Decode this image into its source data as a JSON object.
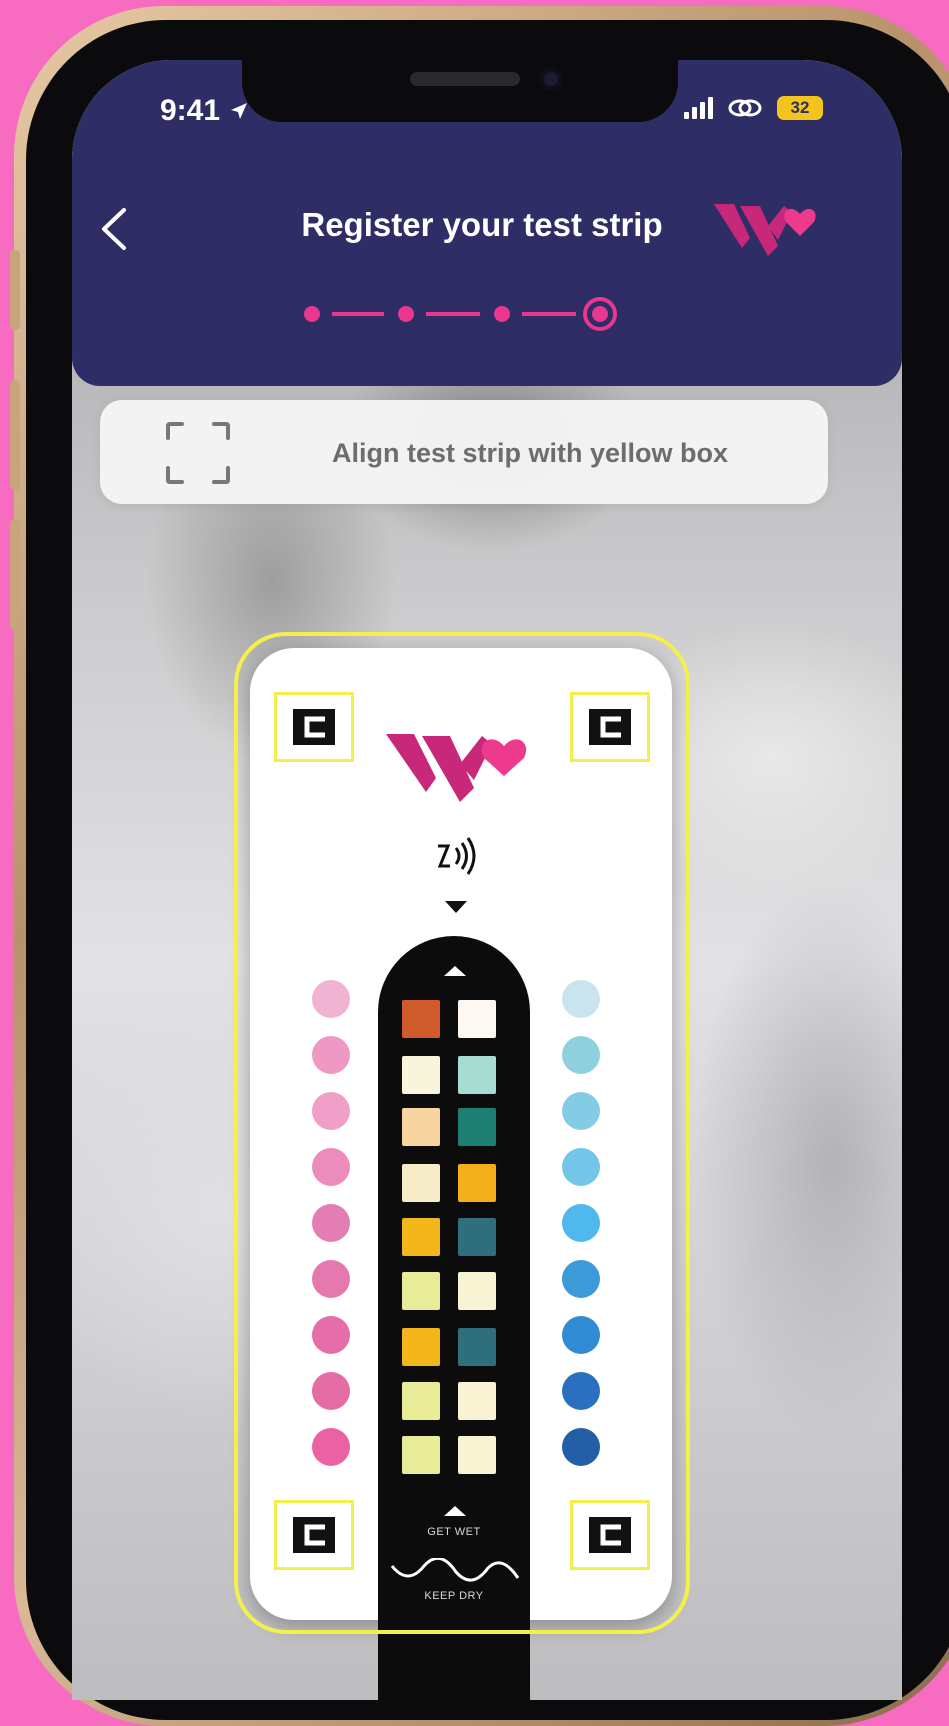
{
  "status_bar": {
    "time": "9:41",
    "battery": "32"
  },
  "header": {
    "title": "Register your test strip",
    "step_current": 4,
    "step_total": 4
  },
  "instruction": {
    "text": "Align test strip with yellow box"
  },
  "strip": {
    "label_get_wet": "GET WET",
    "label_keep_dry": "KEEP DRY",
    "left_dots": [
      "#f0b4d2",
      "#f098c4",
      "#f0a0c8",
      "#ec8cbc",
      "#e47eb2",
      "#e678b0",
      "#e66ea8",
      "#e66ca6",
      "#ea62a2"
    ],
    "right_dots": [
      "#c9e4ec",
      "#8ed0de",
      "#84cce6",
      "#74c6e8",
      "#4fb8ec",
      "#3c9ad8",
      "#308ad4",
      "#2a70be",
      "#245ea6"
    ],
    "pads_left": [
      "#cf5a2a",
      "#f9f5dc",
      "#f7d4a0",
      "#f7ecc8",
      "#f3b71c",
      "#e9ec96",
      "#f3b71c",
      "#e9ec96",
      "#e9ec96"
    ],
    "pads_right": [
      "#fdf8f2",
      "#a6dcd2",
      "#1f7e72",
      "#f3ae1c",
      "#2f6e7c",
      "#f8f3d2",
      "#2f6e7c",
      "#f8f3d2",
      "#f8f3d2"
    ]
  },
  "colors": {
    "header_bg": "#2e2d66",
    "brand_magenta": "#c8287a",
    "brand_pink": "#ee3a8c",
    "guide_yellow": "#f4ef4c"
  }
}
